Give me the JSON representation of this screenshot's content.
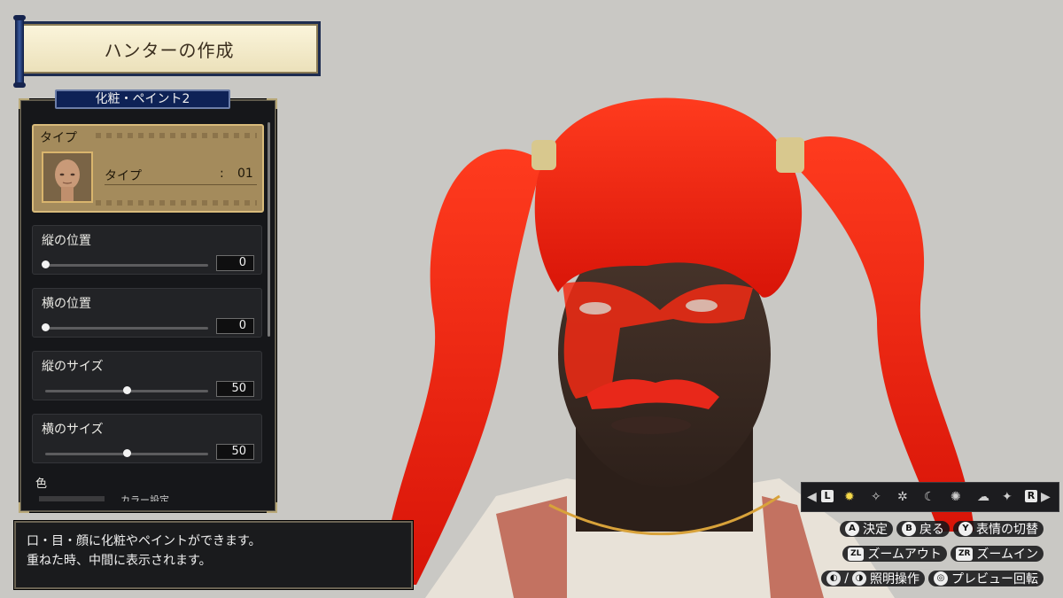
{
  "header": {
    "title": "ハンターの作成"
  },
  "panel": {
    "title": "化粧・ペイント2",
    "type": {
      "section_label": "タイプ",
      "row_label": "タイプ",
      "colon": ":",
      "value": "01"
    },
    "sliders": [
      {
        "label": "縦の位置",
        "value": "0",
        "fraction": 0.0
      },
      {
        "label": "横の位置",
        "value": "0",
        "fraction": 0.0
      },
      {
        "label": "縦のサイズ",
        "value": "50",
        "fraction": 0.5
      },
      {
        "label": "横のサイズ",
        "value": "50",
        "fraction": 0.5
      }
    ],
    "color": {
      "label": "色",
      "partial_text": "カラー設定"
    }
  },
  "description": {
    "line1": "口・目・顔に化粧やペイントができます。",
    "line2": "重ねた時、中間に表示されます。"
  },
  "lighting_bar": {
    "left_button": "L",
    "right_button": "R"
  },
  "controls": {
    "row1": [
      {
        "button": "A",
        "label": "決定"
      },
      {
        "button": "B",
        "label": "戻る"
      },
      {
        "button": "Y",
        "label": "表情の切替"
      }
    ],
    "row2": [
      {
        "button": "ZL",
        "label": "ズームアウト"
      },
      {
        "button": "ZR",
        "label": "ズームイン"
      }
    ],
    "row3": {
      "sep": "/",
      "lighting_label": "照明操作",
      "preview_label": "プレビュー回転"
    }
  },
  "colors": {
    "hair": "#f01e0a",
    "skin": "#3a2a22",
    "panel_bg": "#16171a",
    "selected_card": "#a48b5c",
    "header_blue": "#0e2256"
  }
}
